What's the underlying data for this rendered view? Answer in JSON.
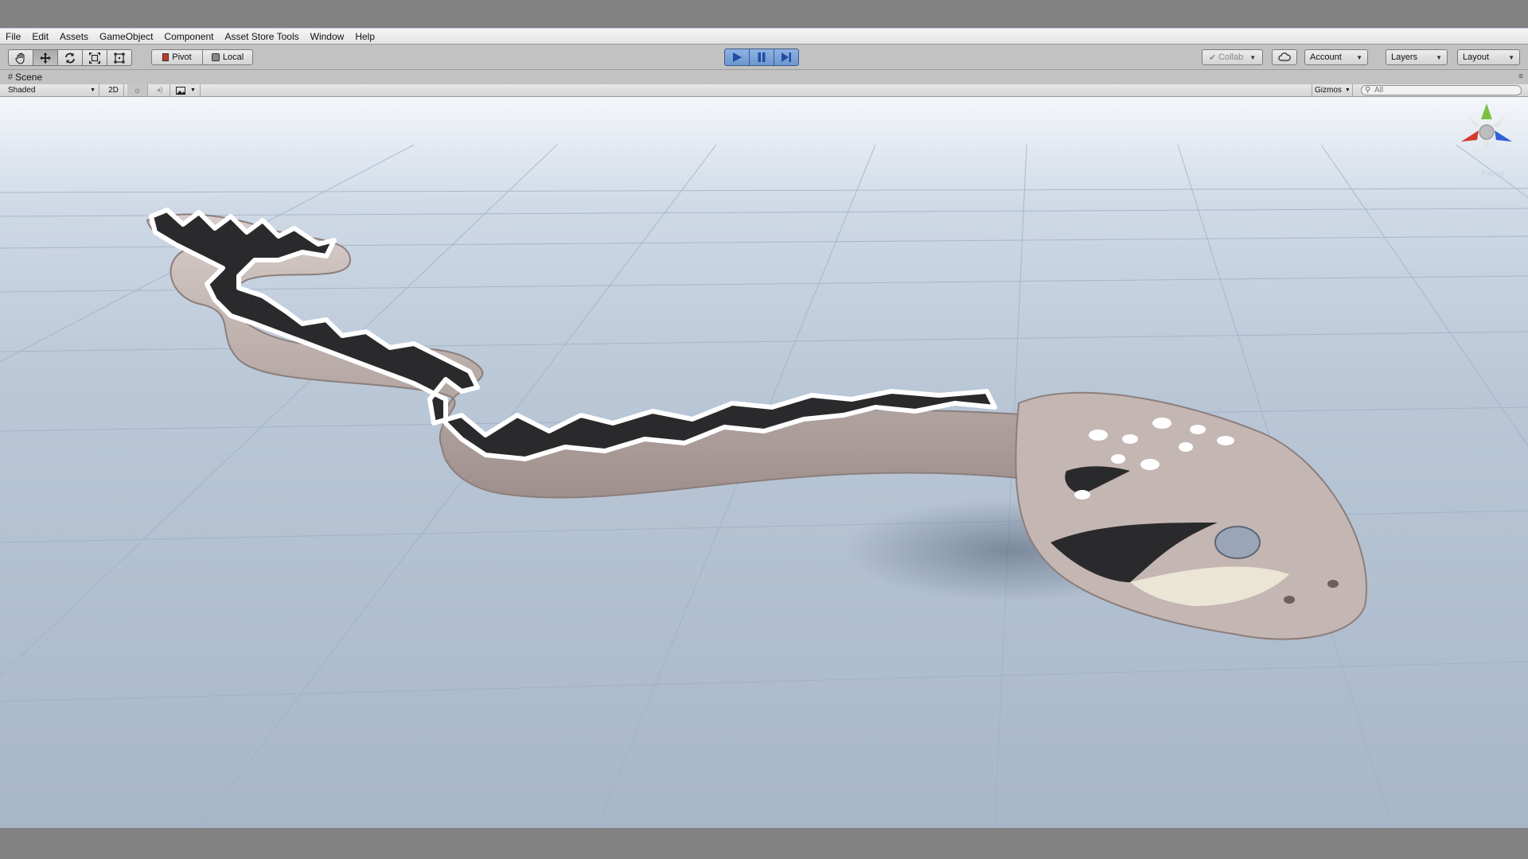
{
  "menu": {
    "items": [
      "File",
      "Edit",
      "Assets",
      "GameObject",
      "Component",
      "Asset Store Tools",
      "Window",
      "Help"
    ]
  },
  "toolbar": {
    "tools": [
      "hand-tool-icon",
      "move-tool-icon",
      "rotate-tool-icon",
      "scale-tool-icon",
      "rect-tool-icon"
    ],
    "pivot_label": "Pivot",
    "local_label": "Local",
    "collab_label": "Collab",
    "account_label": "Account",
    "layers_label": "Layers",
    "layout_label": "Layout"
  },
  "scene": {
    "tab_label": "Scene",
    "shading_mode": "Shaded",
    "mode_2d_label": "2D",
    "gizmos_label": "Gizmos",
    "search_placeholder": "All",
    "persp_label": "Persp"
  },
  "colors": {
    "play_button": "#6d95cf",
    "snake_body": "#b8a9a6",
    "snake_pattern": "#2a2a2c",
    "snake_stripe": "#ffffff",
    "axis_x": "#d23a2e",
    "axis_y": "#7ac143",
    "axis_z": "#2f62d8"
  }
}
